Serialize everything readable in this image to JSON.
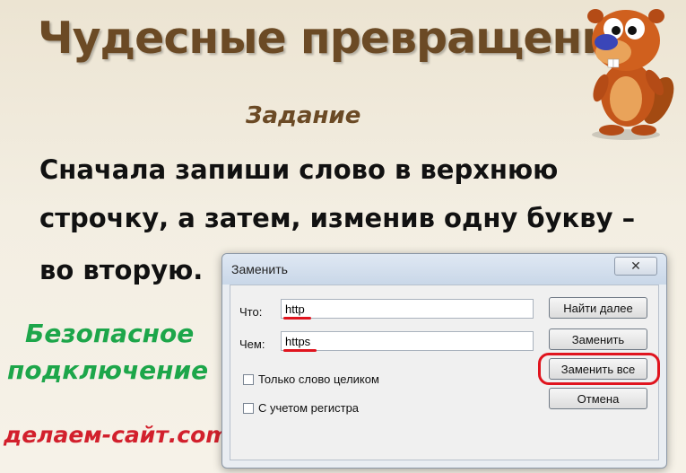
{
  "slide": {
    "title": "Чудесные превращения",
    "subtitle": "Задание",
    "task_lines": [
      "Сначала запиши слово в верхнюю",
      "строчку, а затем, изменив одну букву –",
      "во вторую."
    ],
    "caption_line1": "Безопасное",
    "caption_line2": "подключение",
    "site": "делаем-сайт.com"
  },
  "dialog": {
    "title": "Заменить",
    "close_label": "✕",
    "find_label": "Что:",
    "find_value": "http",
    "replace_label": "Чем:",
    "replace_value": "https",
    "checkbox_whole_word": "Только слово целиком",
    "checkbox_match_case": "С учетом регистра",
    "buttons": {
      "find_next": "Найти далее",
      "replace": "Заменить",
      "replace_all": "Заменить все",
      "cancel": "Отмена"
    }
  },
  "colors": {
    "title": "#6b4a25",
    "green": "#1da64a",
    "red": "#d2202c",
    "highlight": "#e0141e"
  },
  "icons": [
    "beaver-mascot-icon",
    "close-icon",
    "checkbox-icon"
  ]
}
